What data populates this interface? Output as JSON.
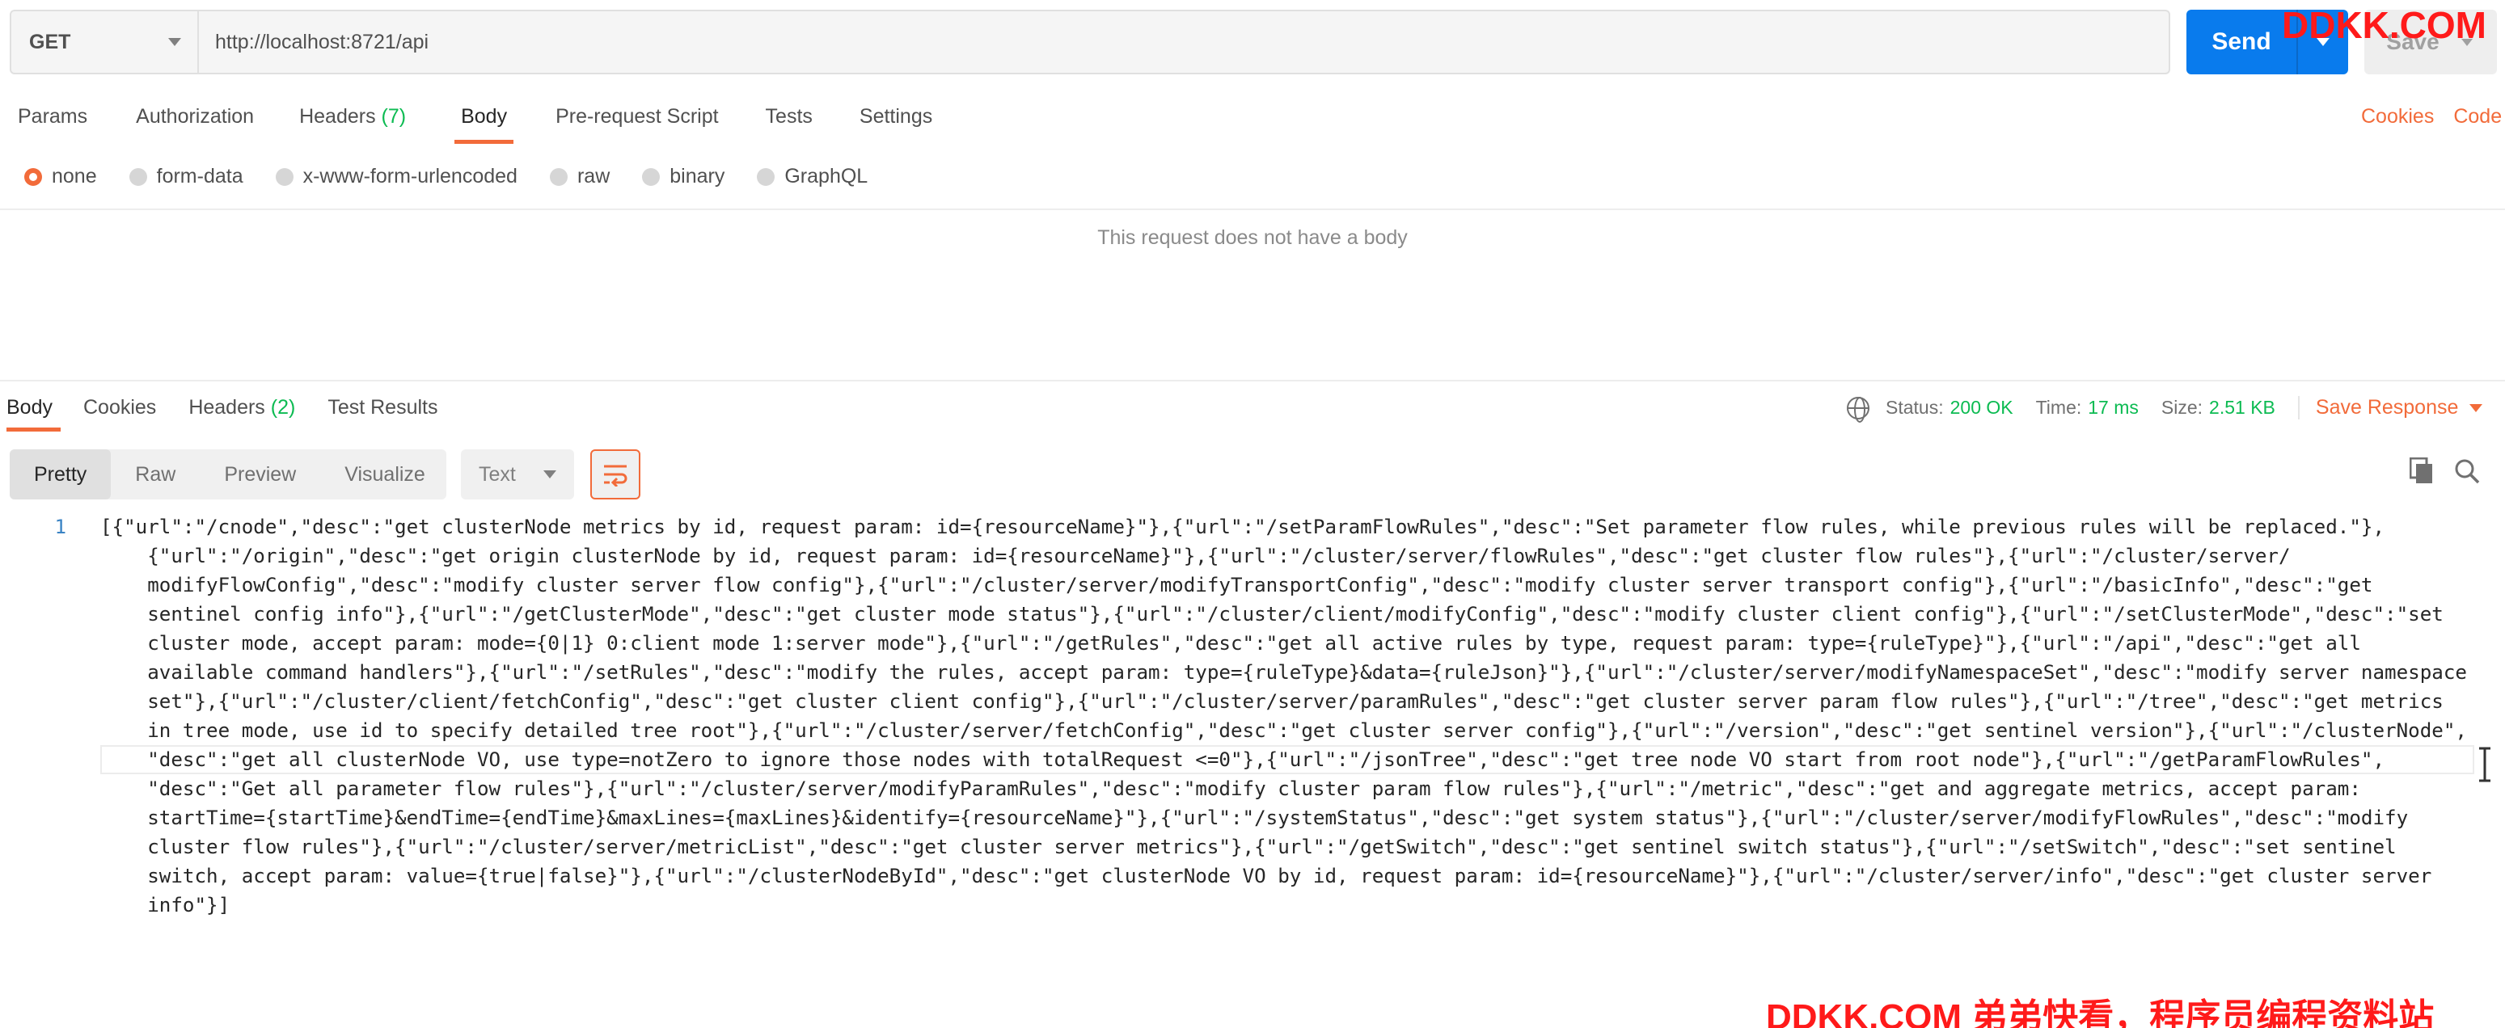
{
  "request": {
    "method": "GET",
    "url": "http://localhost:8721/api",
    "send_label": "Send",
    "save_label": "Save"
  },
  "watermark": {
    "top": "DDKK.COM",
    "bottom": "DDKK.COM 弟弟快看，程序员编程资料站"
  },
  "request_tabs": {
    "params": "Params",
    "authorization": "Authorization",
    "headers": "Headers",
    "headers_count": "(7)",
    "body": "Body",
    "prerequest": "Pre-request Script",
    "tests": "Tests",
    "settings": "Settings",
    "cookies": "Cookies",
    "code": "Code"
  },
  "body_types": {
    "selected": "none",
    "none": "none",
    "form_data": "form-data",
    "urlencoded": "x-www-form-urlencoded",
    "raw": "raw",
    "binary": "binary",
    "graphql": "GraphQL"
  },
  "no_body_message": "This request does not have a body",
  "response_tabs": {
    "body": "Body",
    "cookies": "Cookies",
    "headers": "Headers",
    "headers_count": "(2)",
    "test_results": "Test Results"
  },
  "response_status": {
    "status_label": "Status:",
    "status_value": "200 OK",
    "time_label": "Time:",
    "time_value": "17 ms",
    "size_label": "Size:",
    "size_value": "2.51 KB",
    "save_response": "Save Response"
  },
  "view_modes": {
    "pretty": "Pretty",
    "raw": "Raw",
    "preview": "Preview",
    "visualize": "Visualize",
    "format": "Text"
  },
  "colors": {
    "accent": "#f26b3a",
    "send": "#097bed",
    "success": "#0cbb52",
    "line_number": "#3a83c4"
  },
  "response_body": {
    "line_number": "1",
    "lines": [
      "[{\"url\":\"/cnode\",\"desc\":\"get clusterNode metrics by id, request param: id={resourceName}\"},{\"url\":\"/setParamFlowRules\",\"desc\":\"Set parameter flow rules, while previous rules will be replaced.\"},",
      "    {\"url\":\"/origin\",\"desc\":\"get origin clusterNode by id, request param: id={resourceName}\"},{\"url\":\"/cluster/server/flowRules\",\"desc\":\"get cluster flow rules\"},{\"url\":\"/cluster/server/",
      "    modifyFlowConfig\",\"desc\":\"modify cluster server flow config\"},{\"url\":\"/cluster/server/modifyTransportConfig\",\"desc\":\"modify cluster server transport config\"},{\"url\":\"/basicInfo\",\"desc\":\"get",
      "    sentinel config info\"},{\"url\":\"/getClusterMode\",\"desc\":\"get cluster mode status\"},{\"url\":\"/cluster/client/modifyConfig\",\"desc\":\"modify cluster client config\"},{\"url\":\"/setClusterMode\",\"desc\":\"set",
      "    cluster mode, accept param: mode={0|1} 0:client mode 1:server mode\"},{\"url\":\"/getRules\",\"desc\":\"get all active rules by type, request param: type={ruleType}\"},{\"url\":\"/api\",\"desc\":\"get all",
      "    available command handlers\"},{\"url\":\"/setRules\",\"desc\":\"modify the rules, accept param: type={ruleType}&data={ruleJson}\"},{\"url\":\"/cluster/server/modifyNamespaceSet\",\"desc\":\"modify server namespace",
      "    set\"},{\"url\":\"/cluster/client/fetchConfig\",\"desc\":\"get cluster client config\"},{\"url\":\"/cluster/server/paramRules\",\"desc\":\"get cluster server param flow rules\"},{\"url\":\"/tree\",\"desc\":\"get metrics",
      "    in tree mode, use id to specify detailed tree root\"},{\"url\":\"/cluster/server/fetchConfig\",\"desc\":\"get cluster server config\"},{\"url\":\"/version\",\"desc\":\"get sentinel version\"},{\"url\":\"/clusterNode\",",
      "    \"desc\":\"get all clusterNode VO, use type=notZero to ignore those nodes with totalRequest <=0\"},{\"url\":\"/jsonTree\",\"desc\":\"get tree node VO start from root node\"},{\"url\":\"/getParamFlowRules\",",
      "    \"desc\":\"Get all parameter flow rules\"},{\"url\":\"/cluster/server/modifyParamRules\",\"desc\":\"modify cluster param flow rules\"},{\"url\":\"/metric\",\"desc\":\"get and aggregate metrics, accept param:",
      "    startTime={startTime}&endTime={endTime}&maxLines={maxLines}&identify={resourceName}\"},{\"url\":\"/systemStatus\",\"desc\":\"get system status\"},{\"url\":\"/cluster/server/modifyFlowRules\",\"desc\":\"modify",
      "    cluster flow rules\"},{\"url\":\"/cluster/server/metricList\",\"desc\":\"get cluster server metrics\"},{\"url\":\"/getSwitch\",\"desc\":\"get sentinel switch status\"},{\"url\":\"/setSwitch\",\"desc\":\"set sentinel",
      "    switch, accept param: value={true|false}\"},{\"url\":\"/clusterNodeById\",\"desc\":\"get clusterNode VO by id, request param: id={resourceName}\"},{\"url\":\"/cluster/server/info\",\"desc\":\"get cluster server",
      "    info\"}]"
    ]
  }
}
